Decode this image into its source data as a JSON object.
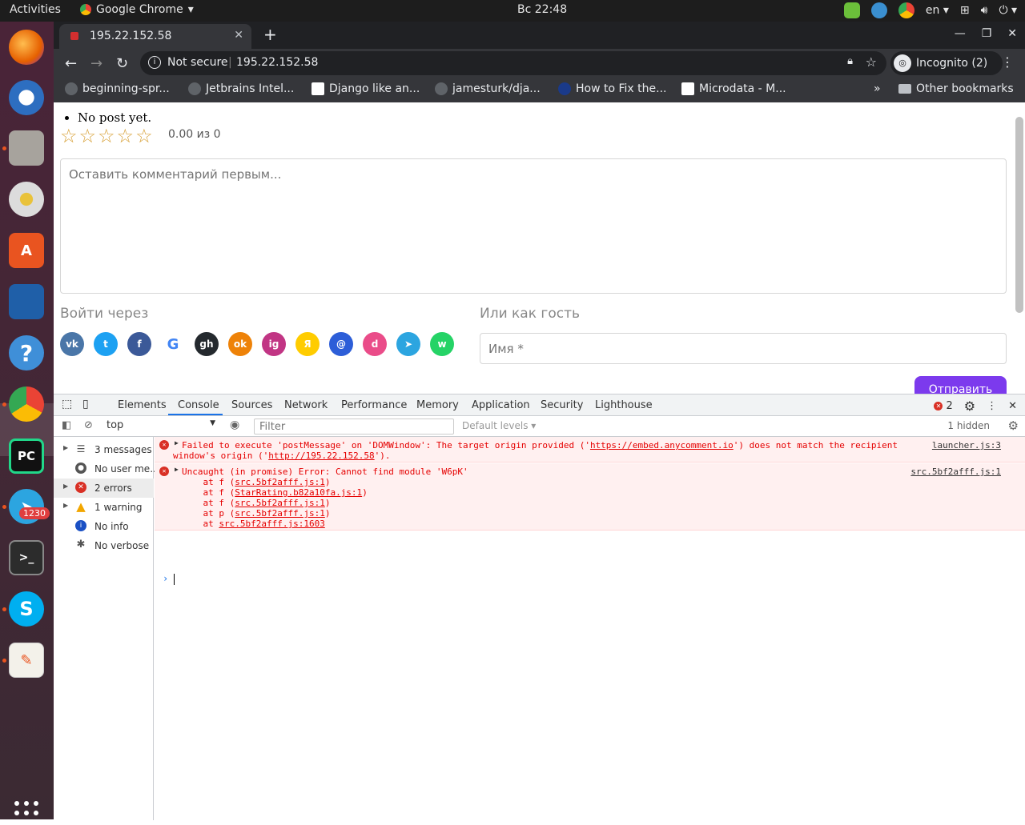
{
  "system": {
    "activities": "Activities",
    "app_name": "Google Chrome",
    "clock": "Вс 22:48",
    "lang": "en",
    "telegram_badge": "1230"
  },
  "browser": {
    "tab_title": "195.22.152.58",
    "not_secure": "Not secure",
    "url": "195.22.152.58",
    "incognito": "Incognito (2)",
    "bookmarks": [
      {
        "label": "beginning-spr..."
      },
      {
        "label": "Jetbrains Intel..."
      },
      {
        "label": "Django like an..."
      },
      {
        "label": "jamesturk/dja..."
      },
      {
        "label": "How to Fix the..."
      },
      {
        "label": "Microdata - M..."
      }
    ],
    "other_bookmarks": "Other bookmarks",
    "overflow": "»"
  },
  "page": {
    "post_text": "No post yet.",
    "rating_text": "0.00 из 0",
    "rating_value": 0,
    "rating_max": 5,
    "comment_placeholder": "Оставить комментарий первым...",
    "login_title": "Войти через",
    "guest_title": "Или как гость",
    "name_placeholder": "Имя *",
    "send_label": "Отправить",
    "socials": [
      {
        "name": "vk-icon",
        "glyph": "vk",
        "color": "#4a76a8"
      },
      {
        "name": "twitter-icon",
        "glyph": "t",
        "color": "#1da1f2"
      },
      {
        "name": "facebook-icon",
        "glyph": "f",
        "color": "#3b5998"
      },
      {
        "name": "google-icon",
        "glyph": "G",
        "color": "#ffffff"
      },
      {
        "name": "github-icon",
        "glyph": "gh",
        "color": "#24292e"
      },
      {
        "name": "odnoklassniki-icon",
        "glyph": "ok",
        "color": "#ee8208"
      },
      {
        "name": "instagram-icon",
        "glyph": "ig",
        "color": "#c13584"
      },
      {
        "name": "yandex-icon",
        "glyph": "Я",
        "color": "#ffcc00"
      },
      {
        "name": "mailru-icon",
        "glyph": "@",
        "color": "#2d5ed8"
      },
      {
        "name": "dribbble-icon",
        "glyph": "d",
        "color": "#ea4c89"
      },
      {
        "name": "telegram-icon",
        "glyph": "➤",
        "color": "#2ca5e0"
      },
      {
        "name": "whatsapp-icon",
        "glyph": "w",
        "color": "#25d366"
      }
    ]
  },
  "devtools": {
    "tabs": [
      "Elements",
      "Console",
      "Sources",
      "Network",
      "Performance",
      "Memory",
      "Application",
      "Security",
      "Lighthouse"
    ],
    "active_tab": "Console",
    "error_count": "2",
    "context": "top",
    "filter_placeholder": "Filter",
    "levels": "Default levels ▾",
    "hidden": "1 hidden",
    "sidebar": [
      {
        "label": "3 messages",
        "icon": "list-icon"
      },
      {
        "label": "No user me...",
        "icon": "user-icon"
      },
      {
        "label": "2 errors",
        "icon": "error-icon"
      },
      {
        "label": "1 warning",
        "icon": "warning-icon"
      },
      {
        "label": "No info",
        "icon": "info-icon"
      },
      {
        "label": "No verbose",
        "icon": "verbose-icon"
      }
    ],
    "messages": [
      {
        "line1_pre": "Failed to execute 'postMessage' on 'DOMWindow': The target origin provided ('",
        "link1": "https://embed.anycomment.io",
        "line1_post": "') does not match the recipient",
        "line2_pre": "window's origin ('",
        "link2": "http://195.22.152.58",
        "line2_post": "').",
        "source": "launcher.js:3"
      },
      {
        "line1": "Uncaught (in promise) Error: Cannot find module 'W6pK'",
        "stack": [
          {
            "pre": "    at f (",
            "link": "src.5bf2afff.js:1",
            "post": ")"
          },
          {
            "pre": "    at f (",
            "link": "StarRating.b82a10fa.js:1",
            "post": ")"
          },
          {
            "pre": "    at f (",
            "link": "src.5bf2afff.js:1",
            "post": ")"
          },
          {
            "pre": "    at p (",
            "link": "src.5bf2afff.js:1",
            "post": ")"
          },
          {
            "pre": "    at ",
            "link": "src.5bf2afff.js:1603",
            "post": ""
          }
        ],
        "source": "src.5bf2afff.js:1"
      }
    ]
  }
}
